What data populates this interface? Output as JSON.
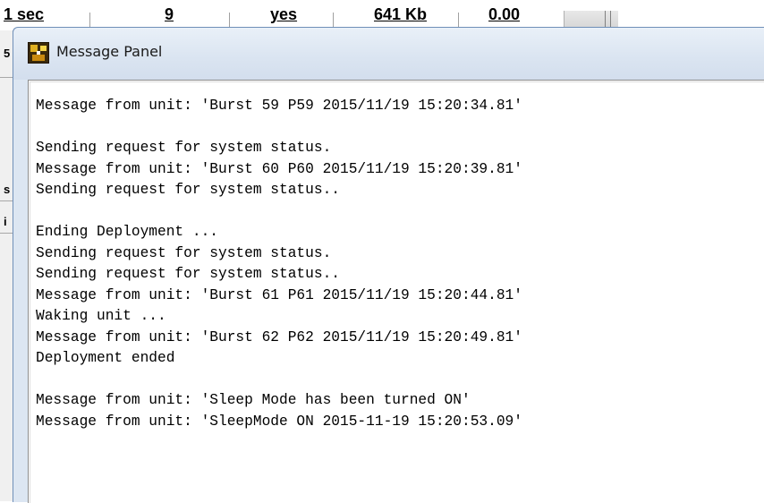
{
  "background_table": {
    "left_cells": [
      "1 sec",
      "9",
      "yes",
      "641 Kb",
      "0.00"
    ],
    "left_glyphs": [
      "5",
      "s",
      "i"
    ]
  },
  "window": {
    "title": "Message Panel",
    "icon": "app-icon"
  },
  "log": {
    "lines": [
      "Message from unit: 'Burst 59 P59 2015/11/19 15:20:34.81'",
      "",
      "Sending request for system status.",
      "Message from unit: 'Burst 60 P60 2015/11/19 15:20:39.81'",
      "Sending request for system status..",
      "",
      "Ending Deployment ...",
      "Sending request for system status.",
      "Sending request for system status..",
      "Message from unit: 'Burst 61 P61 2015/11/19 15:20:44.81'",
      "Waking unit ...",
      "Message from unit: 'Burst 62 P62 2015/11/19 15:20:49.81'",
      "Deployment ended",
      "",
      "Message from unit: 'Sleep Mode has been turned ON'",
      "Message from unit: 'SleepMode ON 2015-11-19 15:20:53.09'"
    ]
  }
}
